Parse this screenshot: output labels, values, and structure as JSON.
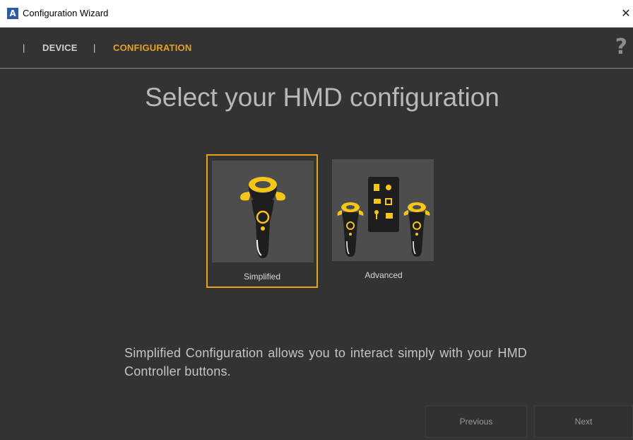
{
  "window": {
    "icon_letter": "A",
    "title": "Configuration Wizard",
    "close_glyph": "✕"
  },
  "nav": {
    "separator": "|",
    "items": [
      {
        "label": "DEVICE",
        "active": false
      },
      {
        "label": "CONFIGURATION",
        "active": true
      }
    ],
    "help_glyph": "?"
  },
  "heading": "Select your HMD configuration",
  "options": [
    {
      "label": "Simplified",
      "selected": true,
      "icon": "single-controller-icon"
    },
    {
      "label": "Advanced",
      "selected": false,
      "icon": "controllers-with-menu-icon"
    }
  ],
  "description": "Simplified Configuration allows you to interact simply with your HMD Controller buttons.",
  "buttons": {
    "previous": "Previous",
    "next": "Next"
  },
  "colors": {
    "background": "#333333",
    "accent": "#e8a020",
    "controller_yellow": "#f5c518",
    "nav_inactive": "#d0d0d0",
    "titlebar_icon": "#2b5ba8"
  }
}
